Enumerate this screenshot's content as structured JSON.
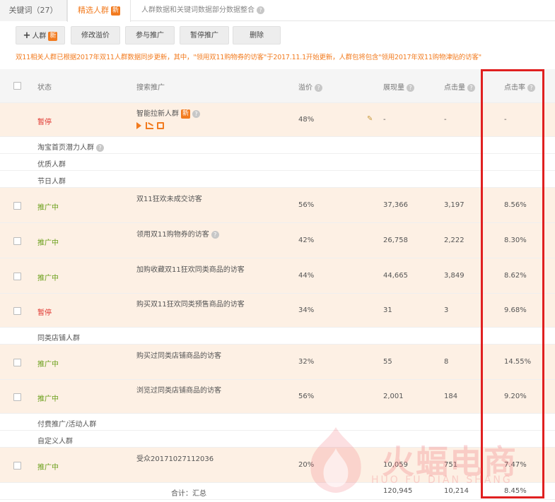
{
  "tabs": {
    "keywords": "关键词（27）",
    "crowd": "精选人群",
    "crowd_badge": "新",
    "data_notice": "人群数据和关键词数据部分数据整合"
  },
  "toolbar": {
    "add_label": "人群",
    "add_badge": "新",
    "edit_label": "修改溢价",
    "join_label": "参与推广",
    "pause_label": "暂停推广",
    "delete_label": "删除"
  },
  "notice": "双11相关人群已根据2017年双11人群数据同步更新，其中，\"领用双11购物券的访客\"于2017.11.1开始更新，人群包将包含\"领用2017年双11购物津贴的访客\"",
  "table": {
    "headers": {
      "status": "状态",
      "name": "搜索推广",
      "premium": "溢价",
      "impressions": "展现量",
      "clicks": "点击量",
      "ctr": "点击率"
    },
    "smart_row": {
      "status": "暂停",
      "name": "智能拉新人群",
      "badge": "新",
      "premium": "48%",
      "impressions": "-",
      "clicks": "-",
      "ctr": "-"
    },
    "groups": {
      "taobao_home": "淘宝首页潜力人群",
      "quality": "优质人群",
      "festival": "节日人群",
      "same_shop": "同类店铺人群",
      "paid_activity": "付费推广/活动人群",
      "custom": "自定义人群"
    },
    "festival_rows": [
      {
        "status": "推广中",
        "name": "双11狂欢未成交访客",
        "premium": "56%",
        "impressions": "37,366",
        "clicks": "3,197",
        "ctr": "8.56%"
      },
      {
        "status": "推广中",
        "name": "领用双11购物券的访客",
        "premium": "42%",
        "impressions": "26,758",
        "clicks": "2,222",
        "ctr": "8.30%"
      },
      {
        "status": "推广中",
        "name": "加购收藏双11狂欢同类商品的访客",
        "premium": "44%",
        "impressions": "44,665",
        "clicks": "3,849",
        "ctr": "8.62%"
      },
      {
        "status": "暂停",
        "name": "购买双11狂欢同类预售商品的访客",
        "premium": "34%",
        "impressions": "31",
        "clicks": "3",
        "ctr": "9.68%"
      }
    ],
    "shop_rows": [
      {
        "status": "推广中",
        "name": "购买过同类店铺商品的访客",
        "premium": "32%",
        "impressions": "55",
        "clicks": "8",
        "ctr": "14.55%"
      },
      {
        "status": "推广中",
        "name": "浏览过同类店铺商品的访客",
        "premium": "56%",
        "impressions": "2,001",
        "clicks": "184",
        "ctr": "9.20%"
      }
    ],
    "custom_rows": [
      {
        "status": "推广中",
        "name": "受众20171027112036",
        "premium": "20%",
        "impressions": "10,059",
        "clicks": "751",
        "ctr": "7.47%"
      }
    ],
    "total": {
      "label": "合计：汇总",
      "impressions": "120,945",
      "clicks": "10,214",
      "ctr": "8.45%"
    }
  },
  "watermark": {
    "text": "火蝠电商",
    "sub": "HUO FU DIAN SHANG"
  },
  "colors": {
    "accent": "#f27b1f",
    "paused": "#e0332c",
    "active": "#6a9f1a",
    "highlight": "#e02020",
    "row_bg": "#fdf0e4"
  }
}
